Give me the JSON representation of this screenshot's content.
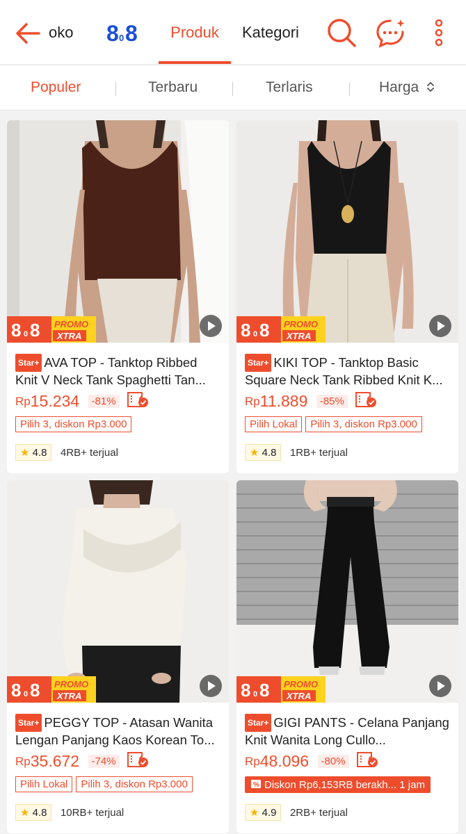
{
  "header": {
    "shop_name": "oko",
    "tab_produk": "Produk",
    "tab_kategori": "Kategori"
  },
  "sort": {
    "populer": "Populer",
    "terbaru": "Terbaru",
    "terlaris": "Terlaris",
    "harga": "Harga"
  },
  "promo": {
    "logo": "8.8",
    "label_top": "PROMO",
    "label_bottom": "XTRA"
  },
  "star_badge": "Star+",
  "products": [
    {
      "title": "AVA TOP - Tanktop Ribbed Knit V Neck Tank Spaghetti Tan...",
      "currency": "Rp",
      "price": "15.234",
      "discount": "-81%",
      "chips": [
        "Pilih 3, diskon Rp3.000"
      ],
      "rating": "4.8",
      "sold": "4RB+ terjual"
    },
    {
      "title": "KIKI TOP - Tanktop Basic Square Neck Tank Ribbed Knit K...",
      "currency": "Rp",
      "price": "11.889",
      "discount": "-85%",
      "chips": [
        "Pilih Lokal",
        "Pilih 3, diskon Rp3.000"
      ],
      "rating": "4.8",
      "sold": "1RB+ terjual"
    },
    {
      "title": "PEGGY TOP - Atasan Wanita Lengan Panjang Kaos Korean To...",
      "currency": "Rp",
      "price": "35.672",
      "discount": "-74%",
      "chips": [
        "Pilih Lokal",
        "Pilih 3, diskon Rp3.000"
      ],
      "rating": "4.8",
      "sold": "10RB+ terjual"
    },
    {
      "title": "GIGI PANTS - Celana Panjang Knit Wanita Long Cullo...",
      "currency": "Rp",
      "price": "48.096",
      "discount": "-80%",
      "flash_deal": "Diskon Rp6,153RB berakh... 1 jam",
      "rating": "4.9",
      "sold": "2RB+ terjual"
    }
  ],
  "colors": {
    "accent": "#ee4d2d",
    "logo_blue": "#1a4fd6",
    "star": "#f7b500"
  }
}
